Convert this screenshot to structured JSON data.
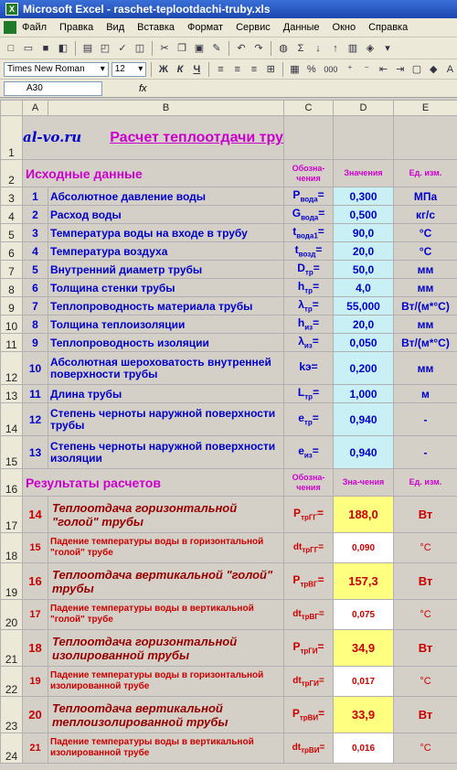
{
  "window": {
    "title": "Microsoft Excel - raschet-teplootdachi-truby.xls"
  },
  "menu": [
    "Файл",
    "Правка",
    "Вид",
    "Вставка",
    "Формат",
    "Сервис",
    "Данные",
    "Окно",
    "Справка"
  ],
  "format_bar": {
    "font": "Times New Roman",
    "size": "12",
    "bold": "Ж",
    "italic": "К",
    "underline": "Ч",
    "percent": "%",
    "thousands": "000"
  },
  "formula_bar": {
    "cell": "A30",
    "fx": "fx",
    "content": ""
  },
  "columns": [
    "A",
    "B",
    "C",
    "D",
    "E"
  ],
  "sheet": {
    "logo": "al-vo.ru",
    "title": "Расчет теплоотдачи трубы",
    "inputs_header": {
      "label": "Исходные данные",
      "sym_col": "Обозна-чения",
      "val_col": "Значения",
      "unit_col": "Ед. изм."
    },
    "inputs": [
      {
        "row": "3",
        "n": "1",
        "desc": "Абсолютное давление воды",
        "sym": "P",
        "sub": "вода",
        "val": "0,300",
        "unit": "МПа"
      },
      {
        "row": "4",
        "n": "2",
        "desc": "Расход воды",
        "sym": "G",
        "sub": "вода",
        "val": "0,500",
        "unit": "кг/с"
      },
      {
        "row": "5",
        "n": "3",
        "desc": "Температура воды на входе в трубу",
        "sym": "t",
        "sub": "вода1",
        "val": "90,0",
        "unit": "°С"
      },
      {
        "row": "6",
        "n": "4",
        "desc": "Температура воздуха",
        "sym": "t",
        "sub": "возд",
        "val": "20,0",
        "unit": "°С"
      },
      {
        "row": "7",
        "n": "5",
        "desc": "Внутренний диаметр трубы",
        "sym": "D",
        "sub": "тр",
        "val": "50,0",
        "unit": "мм"
      },
      {
        "row": "8",
        "n": "6",
        "desc": "Толщина стенки трубы",
        "sym": "h",
        "sub": "тр",
        "val": "4,0",
        "unit": "мм"
      },
      {
        "row": "9",
        "n": "7",
        "desc": "Теплопроводность материала трубы",
        "sym": "λ",
        "sub": "тр",
        "val": "55,000",
        "unit": "Вт/(м*°С)"
      },
      {
        "row": "10",
        "n": "8",
        "desc": "Толщина теплоизоляции",
        "sym": "h",
        "sub": "из",
        "val": "20,0",
        "unit": "мм"
      },
      {
        "row": "11",
        "n": "9",
        "desc": "Теплопроводность изоляции",
        "sym": "λ",
        "sub": "из",
        "val": "0,050",
        "unit": "Вт/(м*°С)"
      },
      {
        "row": "12",
        "n": "10",
        "desc": "Абсолютная шероховатость внутренней поверхности трубы",
        "sym": "kэ",
        "sub": "",
        "val": "0,200",
        "unit": "мм"
      },
      {
        "row": "13",
        "n": "11",
        "desc": "Длина трубы",
        "sym": "L",
        "sub": "тр",
        "val": "1,000",
        "unit": "м"
      },
      {
        "row": "14",
        "n": "12",
        "desc": "Степень черноты наружной поверхности трубы",
        "sym": "e",
        "sub": "тр",
        "val": "0,940",
        "unit": "-"
      },
      {
        "row": "15",
        "n": "13",
        "desc": "Степень черноты наружной поверхности изоляции",
        "sym": "e",
        "sub": "из",
        "val": "0,940",
        "unit": "-"
      }
    ],
    "results_header": {
      "label": "Результаты расчетов",
      "sym_col": "Обозна-чения",
      "val_col": "Зна-чения",
      "unit_col": "Ед. изм."
    },
    "results": [
      {
        "row": "17",
        "n": "14",
        "desc": "Теплоотдача горизонтальной \"голой\" трубы",
        "sym": "P",
        "sub": "трГГ",
        "val": "188,0",
        "unit": "Вт",
        "small": false
      },
      {
        "row": "18",
        "n": "15",
        "desc": "Падение температуры воды в горизонтальной \"голой\" трубе",
        "sym": "dt",
        "sub": "трГГ",
        "val": "0,090",
        "unit": "°С",
        "small": true
      },
      {
        "row": "19",
        "n": "16",
        "desc": "Теплоотдача вертикальной \"голой\" трубы",
        "sym": "P",
        "sub": "трВГ",
        "val": "157,3",
        "unit": "Вт",
        "small": false
      },
      {
        "row": "20",
        "n": "17",
        "desc": "Падение температуры воды в вертикальной \"голой\" трубе",
        "sym": "dt",
        "sub": "трВГ",
        "val": "0,075",
        "unit": "°С",
        "small": true
      },
      {
        "row": "21",
        "n": "18",
        "desc": "Теплоотдача горизонтальной изолированной трубы",
        "sym": "P",
        "sub": "трГИ",
        "val": "34,9",
        "unit": "Вт",
        "small": false
      },
      {
        "row": "22",
        "n": "19",
        "desc": "Падение температуры воды в горизонтальной изолированной трубе",
        "sym": "dt",
        "sub": "трГИ",
        "val": "0,017",
        "unit": "°С",
        "small": true
      },
      {
        "row": "23",
        "n": "20",
        "desc": "Теплоотдача вертикальной теплоизолированной трубы",
        "sym": "P",
        "sub": "трВИ",
        "val": "33,9",
        "unit": "Вт",
        "small": false
      },
      {
        "row": "24",
        "n": "21",
        "desc": "Падение температуры воды в вертикальной изолированной трубе",
        "sym": "dt",
        "sub": "трВИ",
        "val": "0,016",
        "unit": "°С",
        "small": true
      }
    ]
  }
}
